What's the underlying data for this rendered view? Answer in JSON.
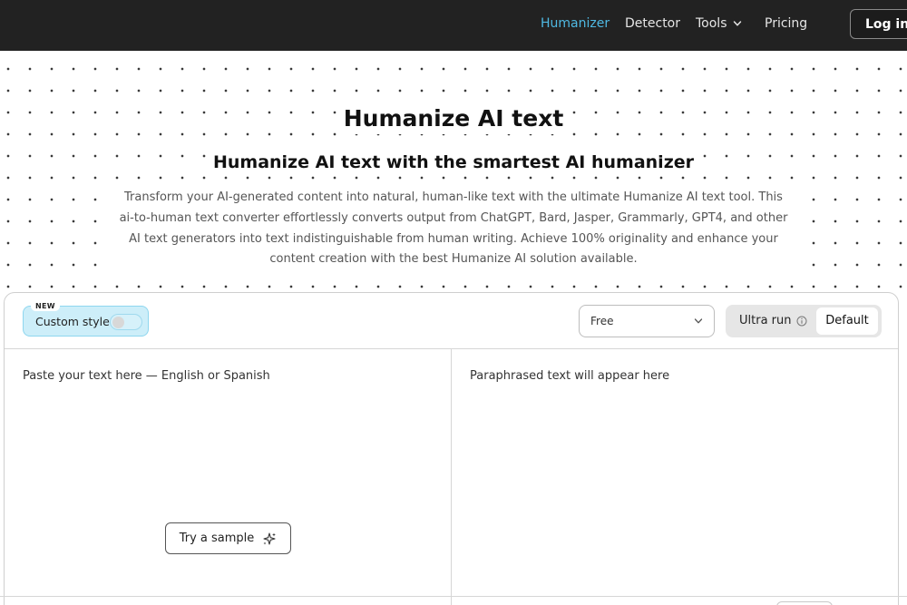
{
  "nav": {
    "items": [
      {
        "label": "Humanizer",
        "active": true
      },
      {
        "label": "Detector",
        "active": false
      },
      {
        "label": "Tools",
        "active": false,
        "has_dropdown": true
      },
      {
        "label": "Pricing",
        "active": false
      }
    ],
    "login_label": "Log in",
    "active_color": "#4fb9e3",
    "bar_color": "#222222"
  },
  "hero": {
    "title": "Humanize AI text",
    "subtitle": "Humanize AI text with the smartest AI humanizer",
    "description": "Transform your AI-generated content into natural, human-like text with the ultimate Humanize AI text tool. This ai-to-human text converter effortlessly converts output from ChatGPT, Bard, Jasper, Grammarly, GPT4, and other AI text generators into text indistinguishable from human writing. Achieve 100% originality and enhance your content creation with the best Humanize AI solution available."
  },
  "toolbar": {
    "new_badge": "NEW",
    "custom_style_label": "Custom style",
    "custom_style_enabled": false,
    "plan_select_value": "Free",
    "ultra_run_label": "Ultra run",
    "default_label": "Default",
    "accent_color": "#cdeef9"
  },
  "editor": {
    "input_placeholder": "Paste your text here — English or Spanish",
    "output_placeholder": "Paraphrased text will appear here",
    "sample_button_label": "Try a sample"
  },
  "icons": {
    "tools_dropdown": "chevron-down-icon",
    "select_dropdown": "chevron-down-icon",
    "ultra_run_info": "info-icon",
    "sample": "sparkle-icon"
  }
}
